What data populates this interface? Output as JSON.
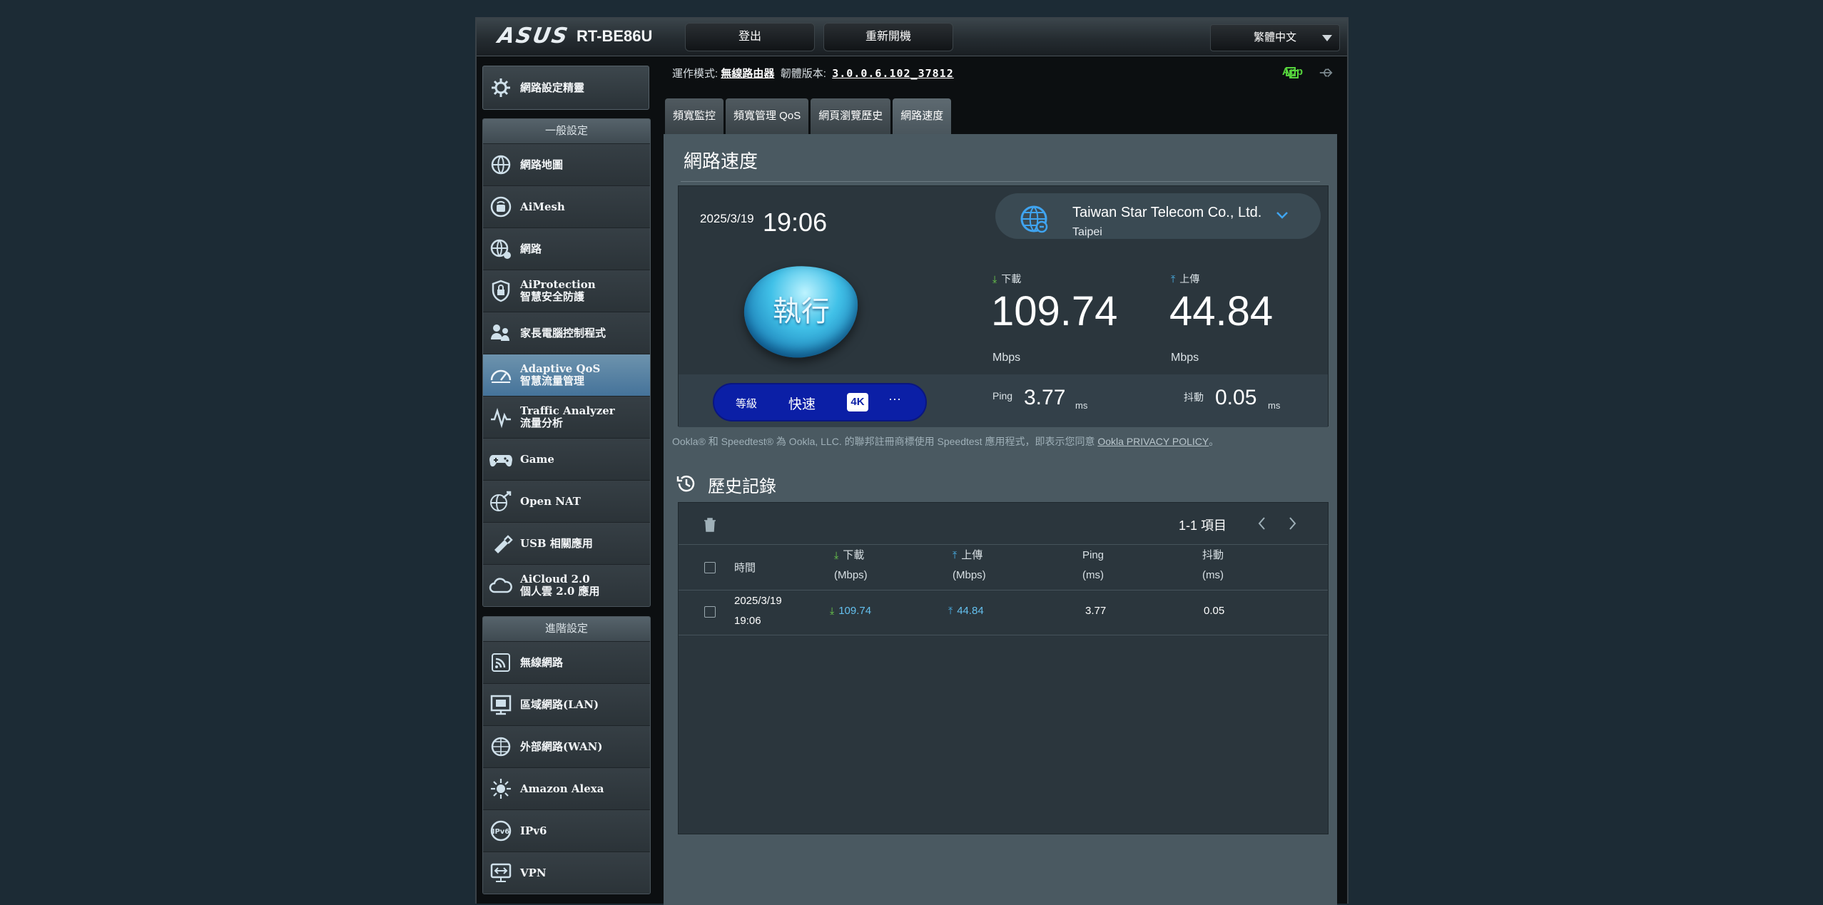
{
  "header": {
    "brand": "ASUS",
    "model": "RT-BE86U",
    "logout_label": "登出",
    "reboot_label": "重新開機",
    "language": "繁體中文"
  },
  "status": {
    "mode_label": "運作模式:",
    "mode_value": "無線路由器",
    "fw_label": "韌體版本:",
    "fw_value": "3.0.0.6.102_37812",
    "app_label": "App"
  },
  "sidebar": {
    "qis_label": "網路設定精靈",
    "general_header": "一般設定",
    "general_items": [
      {
        "label": "網路地圖",
        "sub": ""
      },
      {
        "label": "AiMesh",
        "sub": ""
      },
      {
        "label": "網路",
        "sub": ""
      },
      {
        "label": "AiProtection",
        "sub": "智慧安全防護"
      },
      {
        "label": "家長電腦控制程式",
        "sub": ""
      },
      {
        "label": "Adaptive QoS",
        "sub": "智慧流量管理"
      },
      {
        "label": "Traffic Analyzer",
        "sub": "流量分析"
      },
      {
        "label": "Game",
        "sub": ""
      },
      {
        "label": "Open NAT",
        "sub": ""
      },
      {
        "label": "USB 相關應用",
        "sub": ""
      },
      {
        "label": "AiCloud 2.0",
        "sub": "個人雲 2.0 應用"
      }
    ],
    "advanced_header": "進階設定",
    "advanced_items": [
      {
        "label": "無線網路"
      },
      {
        "label": "區域網路(LAN)"
      },
      {
        "label": "外部網路(WAN)"
      },
      {
        "label": "Amazon Alexa"
      },
      {
        "label": "IPv6"
      },
      {
        "label": "VPN"
      }
    ]
  },
  "tabs": [
    "頻寬監控",
    "頻寬管理 QoS",
    "網頁瀏覽歷史",
    "網路速度"
  ],
  "speedtest": {
    "title": "網路速度",
    "date": "2025/3/19",
    "time": "19:06",
    "isp_name": "Taiwan Star Telecom Co., Ltd.",
    "isp_city": "Taipei",
    "go_label": "執行",
    "download_label": "下載",
    "download_value": "109.74",
    "download_unit": "Mbps",
    "upload_label": "上傳",
    "upload_value": "44.84",
    "upload_unit": "Mbps",
    "level_label": "等級",
    "level_value": "快速",
    "level_badge": "4K",
    "level_more": "···",
    "ping_label": "Ping",
    "ping_value": "3.77",
    "ping_unit": "ms",
    "jitter_label": "抖動",
    "jitter_value": "0.05",
    "jitter_unit": "ms",
    "ookla_text": "Ookla® 和 Speedtest® 為 Ookla, LLC. 的聯邦註冊商標使用 Speedtest 應用程式，即表示您同意",
    "ookla_link": "Ookla PRIVACY POLICY",
    "ookla_end": "。"
  },
  "history": {
    "title": "歷史記錄",
    "pager": "1-1 項目",
    "columns": {
      "time": "時間",
      "download": "下載",
      "download_unit": "(Mbps)",
      "upload": "上傳",
      "upload_unit": "(Mbps)",
      "ping": "Ping",
      "ping_unit": "(ms)",
      "jitter": "抖動",
      "jitter_unit": "(ms)"
    },
    "rows": [
      {
        "date": "2025/3/19",
        "time": "19:06",
        "download": "109.74",
        "upload": "44.84",
        "ping": "3.77",
        "jitter": "0.05"
      }
    ]
  },
  "colors": {
    "panel": "#4a5961",
    "card": "#2b363d",
    "download_arrow": "#6dd04c",
    "upload_arrow": "#4ab2ea",
    "level_pill": "#0b1fa6",
    "app_green": "#55d23c"
  }
}
